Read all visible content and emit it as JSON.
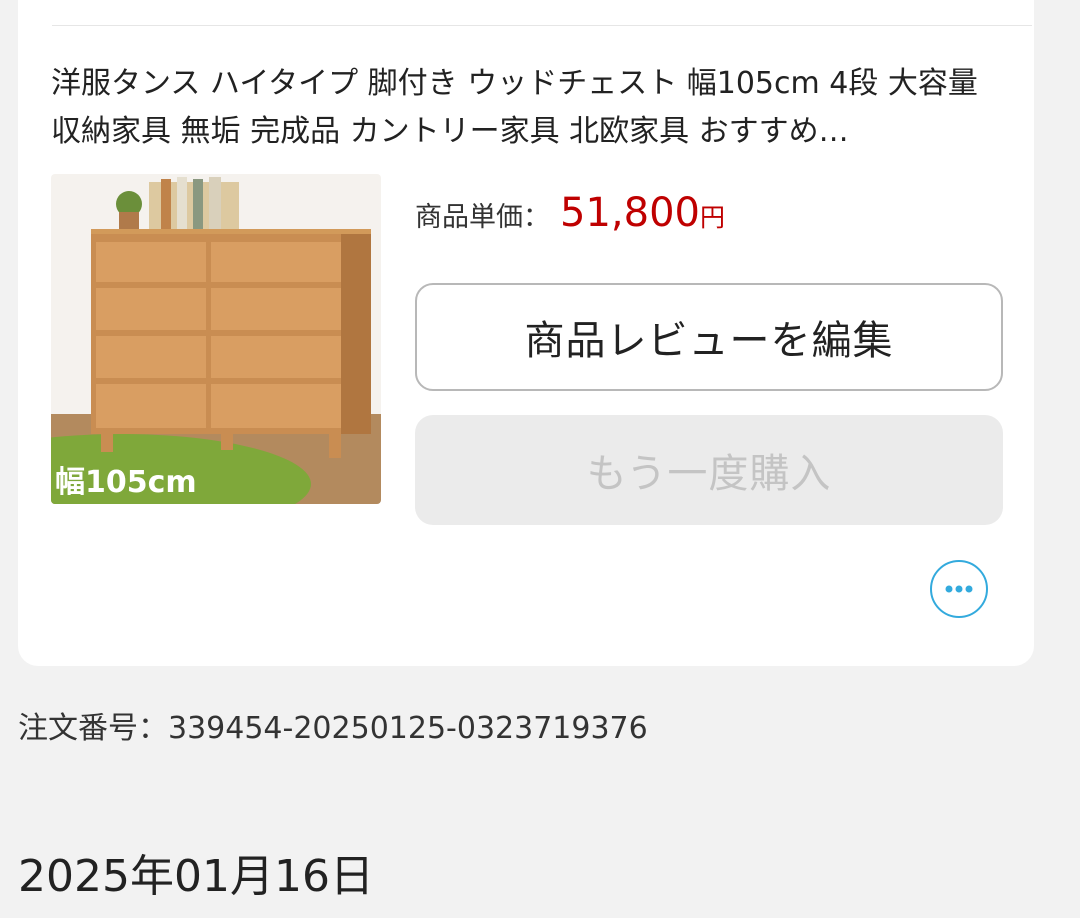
{
  "order": {
    "product_title": "洋服タンス ハイタイプ 脚付き ウッドチェスト 幅105cm 4段 大容量 収納家具 無垢 完成品 カントリー家具 北欧家具 おすすめ…",
    "thumbnail": {
      "overlay_text": "幅105cm",
      "icon": "wooden-chest-photo"
    },
    "price_label": "商品単価：",
    "price_value": "51,800",
    "price_unit": "円",
    "review_button": "商品レビューを編集",
    "rebuy_button": "もう一度購入",
    "more_icon": "ellipsis-icon",
    "order_number": "注文番号：339454-20250125-0323719376"
  },
  "next_group": {
    "date": "2025年01月16日"
  },
  "colors": {
    "price": "#bf0000",
    "accent": "#33aadd",
    "disabled_bg": "#ebebeb",
    "disabled_text": "#c4c4c4"
  }
}
